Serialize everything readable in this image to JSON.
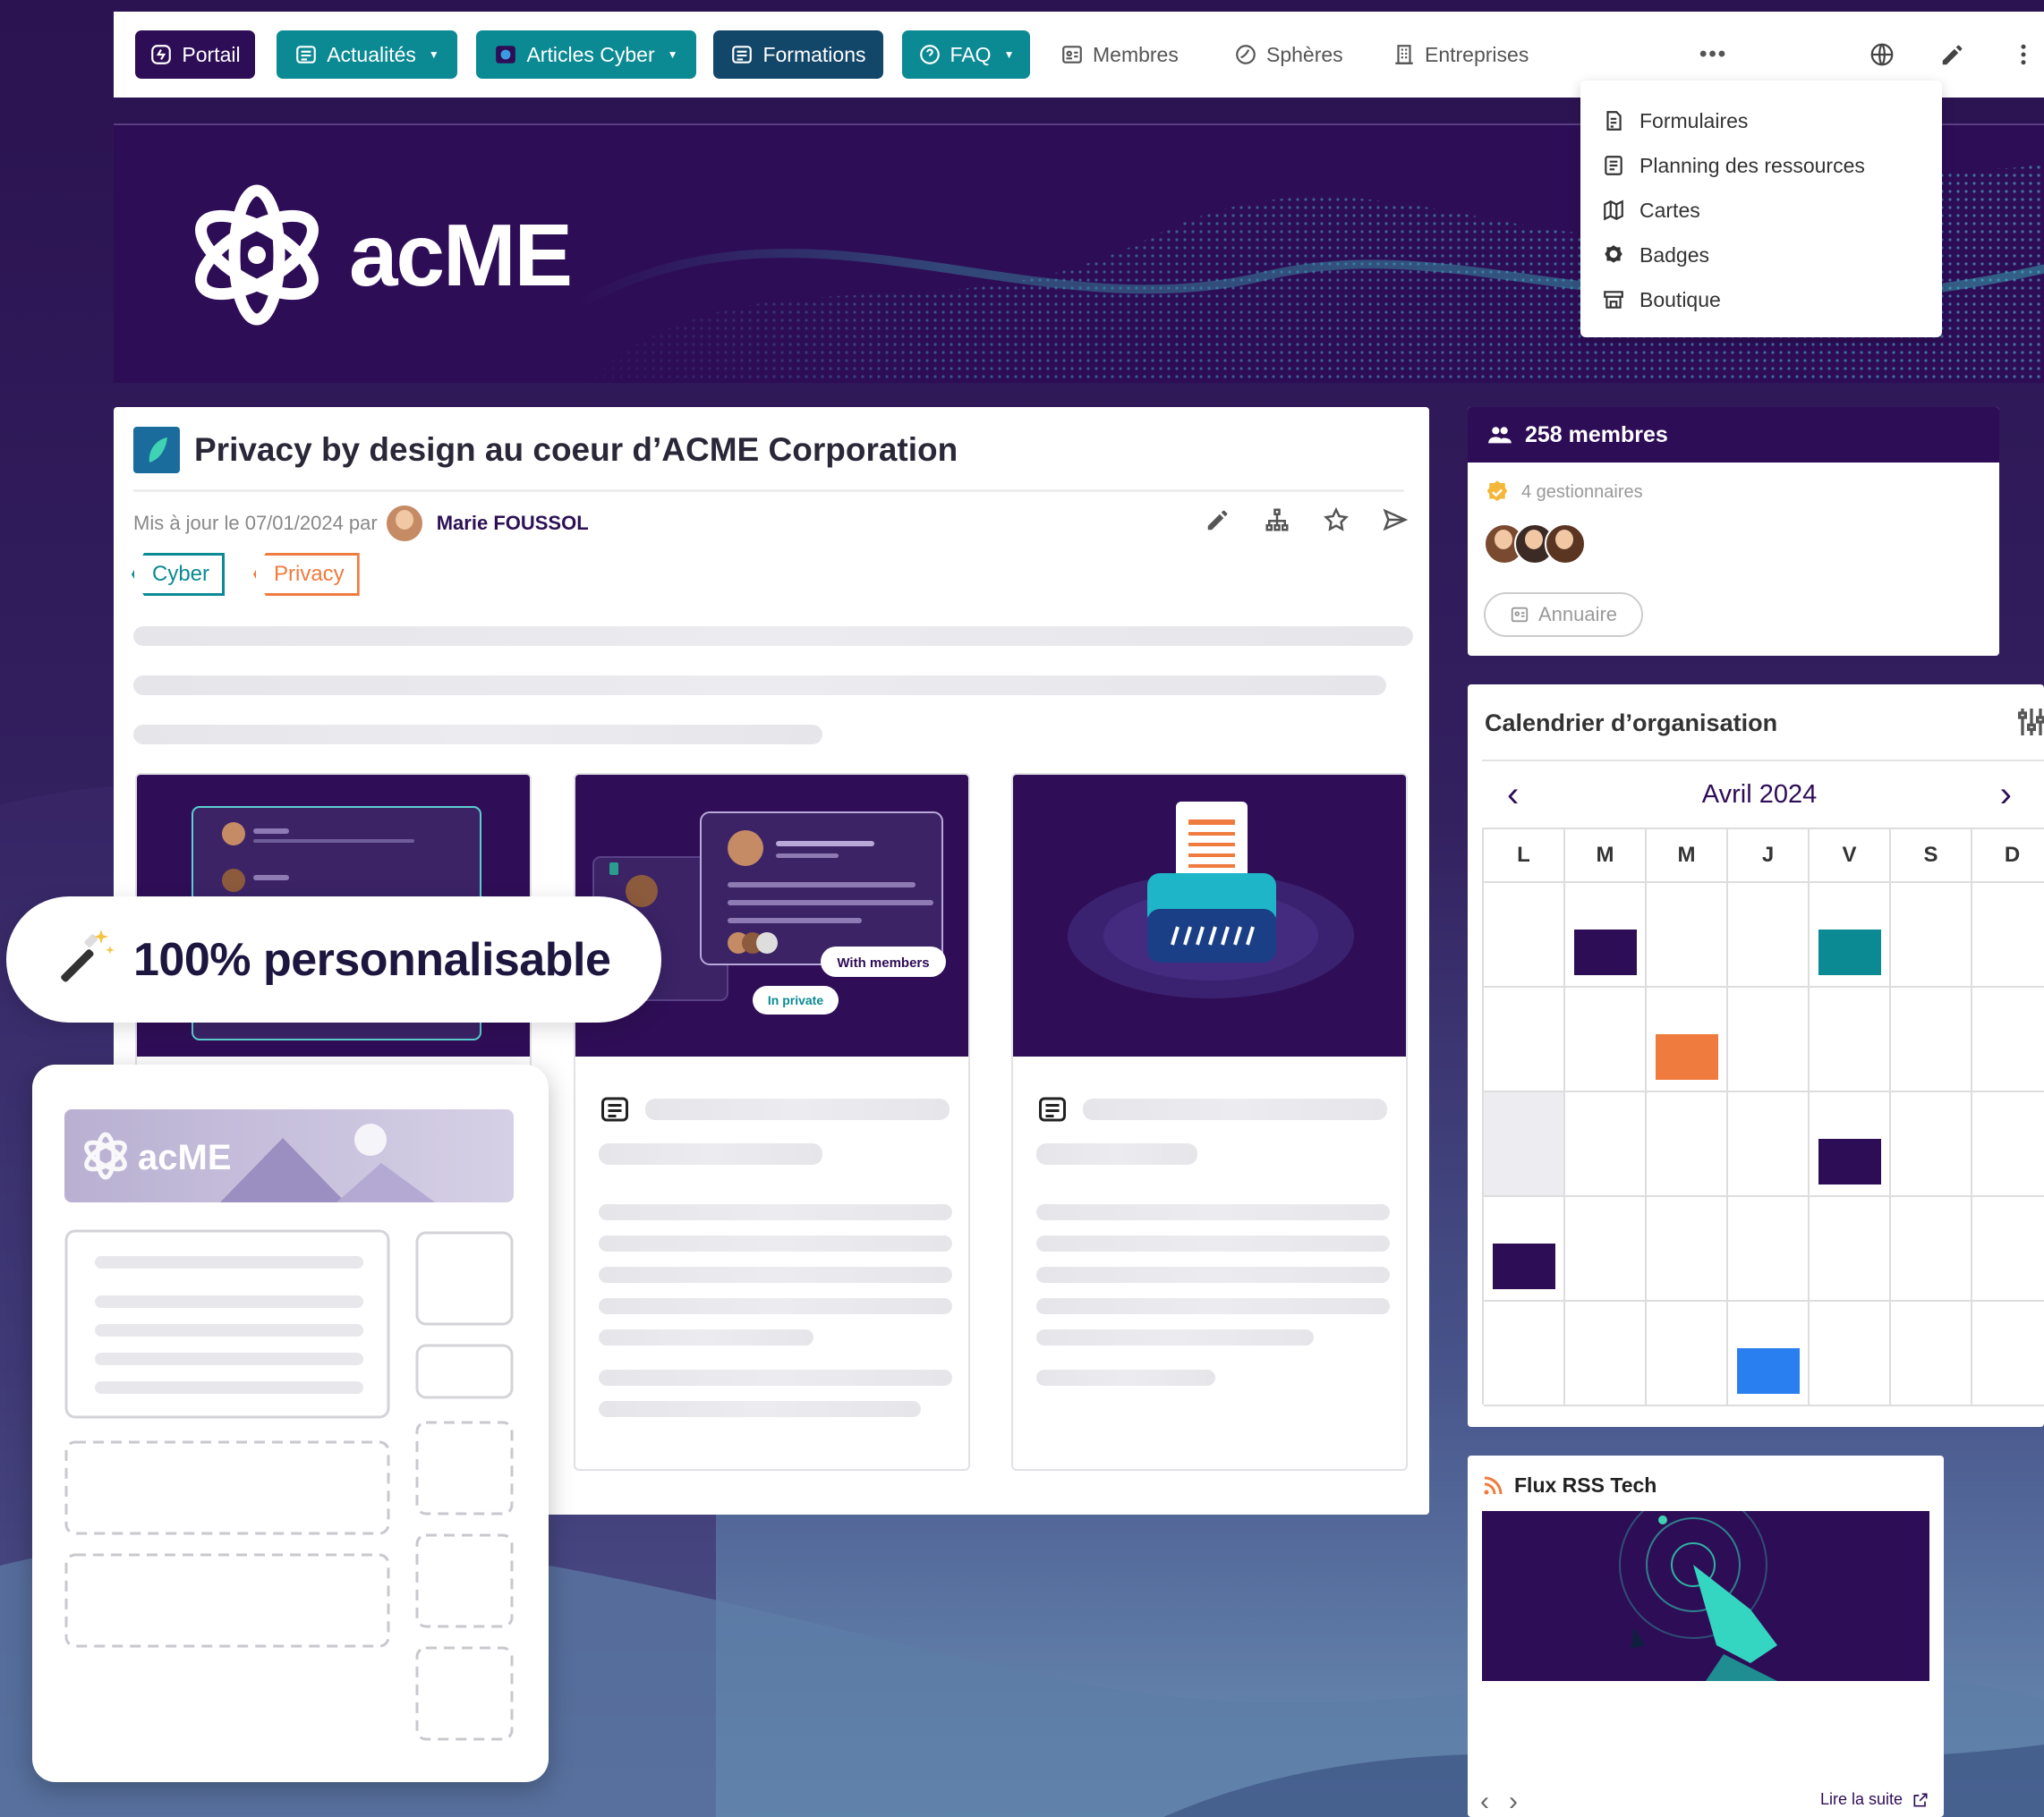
{
  "colors": {
    "brand_dark": "#2e0d57",
    "teal": "#0b8a93",
    "navy": "#13476a",
    "orange": "#f07b3f",
    "blue": "#2a7ff0"
  },
  "nav": {
    "portail": "Portail",
    "actualites": "Actualités",
    "articles_cyber": "Articles Cyber",
    "formations": "Formations",
    "faq": "FAQ",
    "membres": "Membres",
    "spheres": "Sphères",
    "entreprises": "Entreprises",
    "more": "•••",
    "icons": [
      "globe-icon",
      "pencil-icon",
      "kebab-menu-icon"
    ]
  },
  "dropdown": {
    "items": [
      {
        "label": "Formulaires",
        "icon": "form-icon"
      },
      {
        "label": "Planning des ressources",
        "icon": "planning-icon"
      },
      {
        "label": "Cartes",
        "icon": "map-icon"
      },
      {
        "label": "Badges",
        "icon": "badge-icon"
      },
      {
        "label": "Boutique",
        "icon": "store-icon"
      }
    ]
  },
  "banner": {
    "logo_text": "acME"
  },
  "article": {
    "title": "Privacy by design au coeur d’ACME Corporation",
    "meta_prefix": "Mis à jour le 07/01/2024 par",
    "author": "Marie FOUSSOL",
    "tags": [
      "Cyber",
      "Privacy"
    ]
  },
  "promo": {
    "text": "100% personnalisable"
  },
  "builder": {
    "logo_text": "acME"
  },
  "mockups": {
    "with_members": "With members",
    "in_private": "In private"
  },
  "members": {
    "count": "258 membres",
    "managers": "4 gestionnaires",
    "directory": "Annuaire"
  },
  "calendar": {
    "title": "Calendrier d’organisation",
    "month": "Avril 2024",
    "prev": "‹",
    "next": "›",
    "days": [
      "L",
      "M",
      "M",
      "J",
      "V",
      "S",
      "D"
    ]
  },
  "rss": {
    "title": "Flux RSS Tech",
    "read_more": "Lire la suite"
  }
}
